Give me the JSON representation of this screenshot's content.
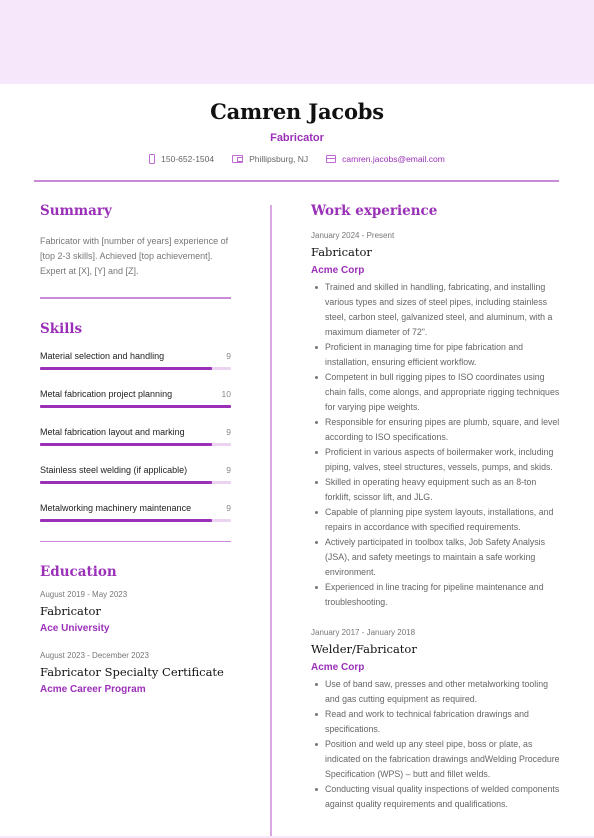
{
  "header": {
    "name": "Camren Jacobs",
    "role": "Fabricator",
    "contacts": {
      "phone": "150-652-1504",
      "location": "Phillipsburg, NJ",
      "email": "camren.jacobs@email.com"
    }
  },
  "colors": {
    "accent": "#9b30b8",
    "accent_light": "#ecd3f1",
    "band": "#f7e7fa",
    "rule": "#c98ad8"
  },
  "summary": {
    "title": "Summary",
    "text": "Fabricator with [number of years] experience of [top 2-3 skills]. Achieved [top achievement]. Expert at [X], [Y] and [Z]."
  },
  "skills": {
    "title": "Skills",
    "max_level": 10,
    "items": [
      {
        "name": "Material selection and handling",
        "level": 9
      },
      {
        "name": "Metal fabrication project planning",
        "level": 10
      },
      {
        "name": "Metal fabrication layout and marking",
        "level": 9
      },
      {
        "name": "Stainless steel welding (if applicable)",
        "level": 9
      },
      {
        "name": "Metalworking machinery maintenance",
        "level": 9
      }
    ]
  },
  "education": {
    "title": "Education",
    "items": [
      {
        "dates": "August 2019 - May 2023",
        "degree": "Fabricator",
        "school": "Ace University"
      },
      {
        "dates": "August 2023 - December 2023",
        "degree": "Fabricator Specialty Certificate",
        "school": "Acme Career Program"
      }
    ]
  },
  "experience": {
    "title": "Work experience",
    "jobs": [
      {
        "dates": "January 2024 - Present",
        "title": "Fabricator",
        "company": "Acme Corp",
        "bullets": [
          "Trained and skilled in handling, fabricating, and installing various types and sizes of steel pipes, including stainless steel, carbon steel, galvanized steel, and aluminum, with a maximum diameter of 72\".",
          "Proficient in managing time for pipe fabrication and installation, ensuring efficient workflow.",
          "Competent in bull rigging pipes to ISO coordinates using chain falls, come alongs, and appropriate rigging techniques for varying pipe weights.",
          "Responsible for ensuring pipes are plumb, square, and level according to ISO specifications.",
          "Proficient in various aspects of boilermaker work, including piping, valves, steel structures, vessels, pumps, and skids.",
          "Skilled in operating heavy equipment such as an 8-ton forklift, scissor lift, and JLG.",
          "Capable of planning pipe system layouts, installations, and repairs in accordance with specified requirements.",
          "Actively participated in toolbox talks, Job Safety Analysis (JSA), and safety meetings to maintain a safe working environment.",
          "Experienced in line tracing for pipeline maintenance and troubleshooting."
        ]
      },
      {
        "dates": "January 2017 - January 2018",
        "title": "Welder/Fabricator",
        "company": "Acme Corp",
        "bullets": [
          "Use of band saw, presses and other metalworking tooling and gas cutting equipment as required.",
          "Read and work to technical fabrication drawings and specifications.",
          "Position and weld up any steel pipe, boss or plate, as indicated on the fabrication drawings andWelding Procedure Specification (WPS) – butt and fillet welds.",
          "Conducting visual quality inspections of welded components against quality requirements and qualifications."
        ]
      }
    ]
  }
}
